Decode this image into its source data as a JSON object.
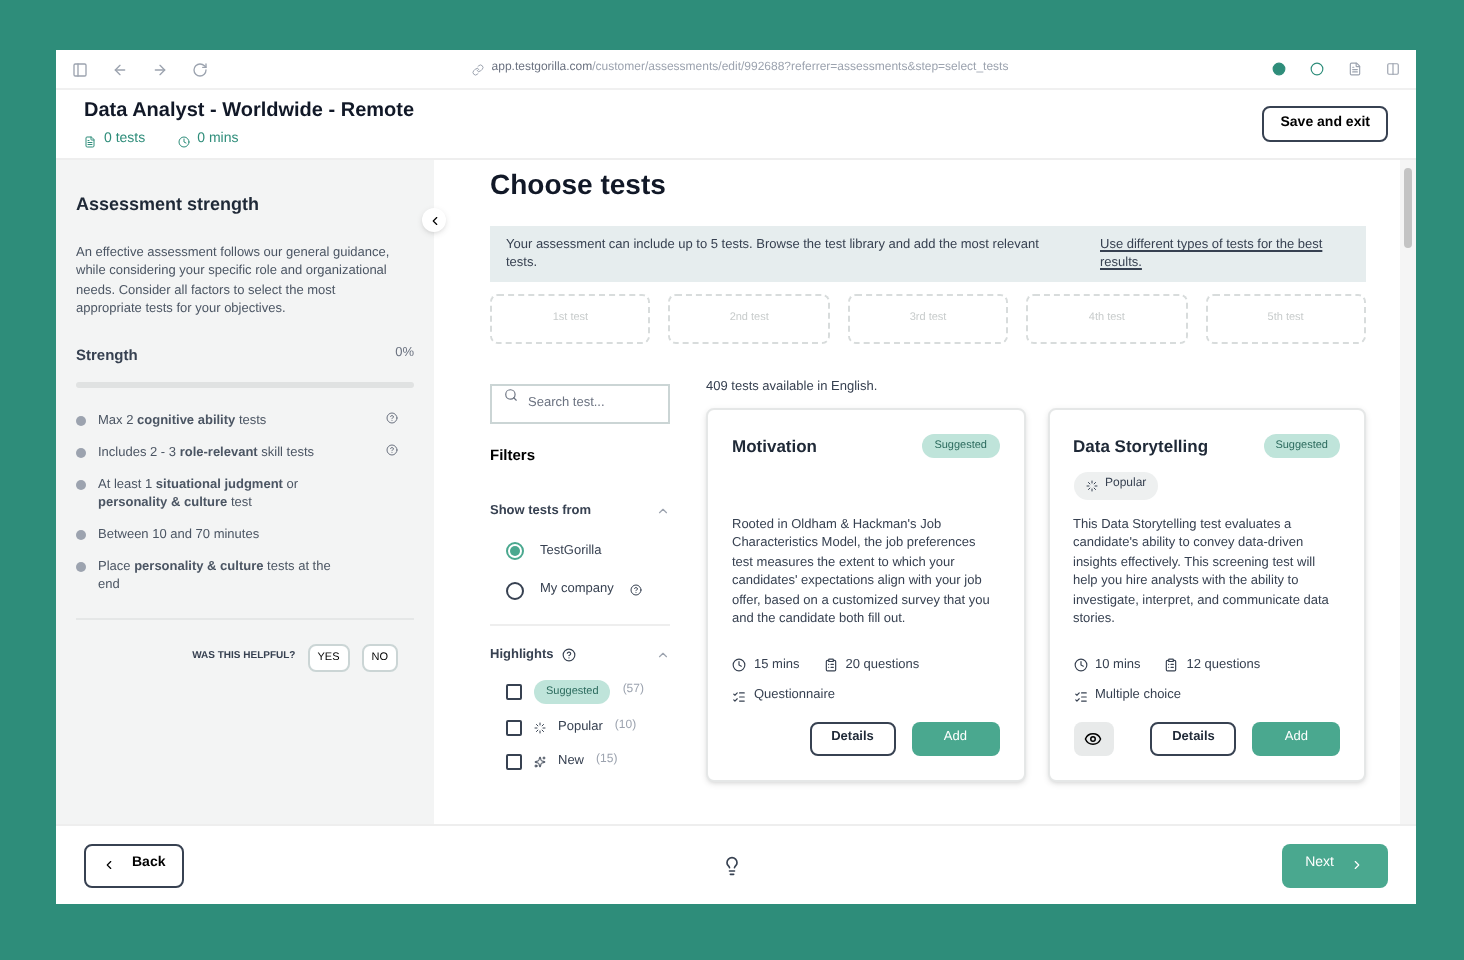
{
  "browser": {
    "url_host": "app.testgorilla.com",
    "url_path": "/customer/assessments/edit/992688?referrer=assessments&step=select_tests"
  },
  "header": {
    "title": "Data Analyst - Worldwide - Remote",
    "tests": "0 tests",
    "mins": "0 mins",
    "save_button": "Save and exit"
  },
  "sidebar": {
    "title": "Assessment strength",
    "description": "An effective assessment follows our general guidance, while considering your specific role and organizational needs. Consider all factors to select the most appropriate tests for your objectives.",
    "strength_label": "Strength",
    "strength_value": "0%",
    "level": 0,
    "rules": [
      {
        "text": "Max 2 **cognitive ability** tests",
        "info": true
      },
      {
        "text": "Includes 2 - 3 **role-relevant** skill tests",
        "info": true
      },
      {
        "text": "At least 1 **situational judgment** or **personality & culture** test",
        "info": false
      },
      {
        "text": "Between 10 and 70 minutes",
        "info": false
      },
      {
        "text": "Place **personality & culture** tests at the end",
        "info": false
      }
    ],
    "helpful": {
      "question": "WAS THIS HELPFUL?",
      "yes": "YES",
      "no": "NO"
    }
  },
  "main": {
    "title": "Choose tests",
    "info_text": "Your assessment can include up to 5 tests. Browse the test library and add the most relevant tests.",
    "info_link": "Use different types of tests for the best results.",
    "slots": [
      "1st test",
      "2nd test",
      "3rd test",
      "4th test",
      "5th test"
    ],
    "search": {
      "placeholder": "Search test..."
    },
    "filters": {
      "title": "Filters",
      "source": {
        "title": "Show tests from",
        "expanded": true,
        "options": [
          {
            "label": "TestGorilla",
            "selected": true,
            "info": false
          },
          {
            "label": "My company",
            "selected": false,
            "info": true
          }
        ]
      },
      "highlights": {
        "title": "Highlights",
        "expanded": true,
        "items": [
          {
            "kind": "badge",
            "label": "Suggested",
            "count": "(57)",
            "checked": false
          },
          {
            "kind": "popular",
            "label": "Popular",
            "count": "(10)",
            "checked": false
          },
          {
            "kind": "new",
            "label": "New",
            "count": "(15)",
            "checked": false
          }
        ]
      }
    },
    "count": "409 tests available in English.",
    "cards": [
      {
        "title": "Motivation",
        "badge": "Suggested",
        "description": "Rooted in Oldham & Hackman's Job Characteristics Model, the job preferences test measures the extent to which your candidates' expectations align with your job offer, based on a customized survey that you and the candidate both fill out.",
        "duration": "15 mins",
        "questions": "20 questions",
        "type": "Questionnaire",
        "preview": false,
        "details": "Details",
        "add": "Add"
      },
      {
        "title": "Data Storytelling",
        "badge": "Suggested",
        "tags": [
          "Popular"
        ],
        "description": "This Data Storytelling test evaluates a candidate's ability to convey data-driven insights effectively. This screening test will help you hire analysts with the ability to investigate, interpret, and communicate data stories.",
        "duration": "10 mins",
        "questions": "12 questions",
        "type": "Multiple choice",
        "preview": true,
        "details": "Details",
        "add": "Add"
      }
    ]
  },
  "footer": {
    "back": "Back",
    "next": "Next"
  }
}
